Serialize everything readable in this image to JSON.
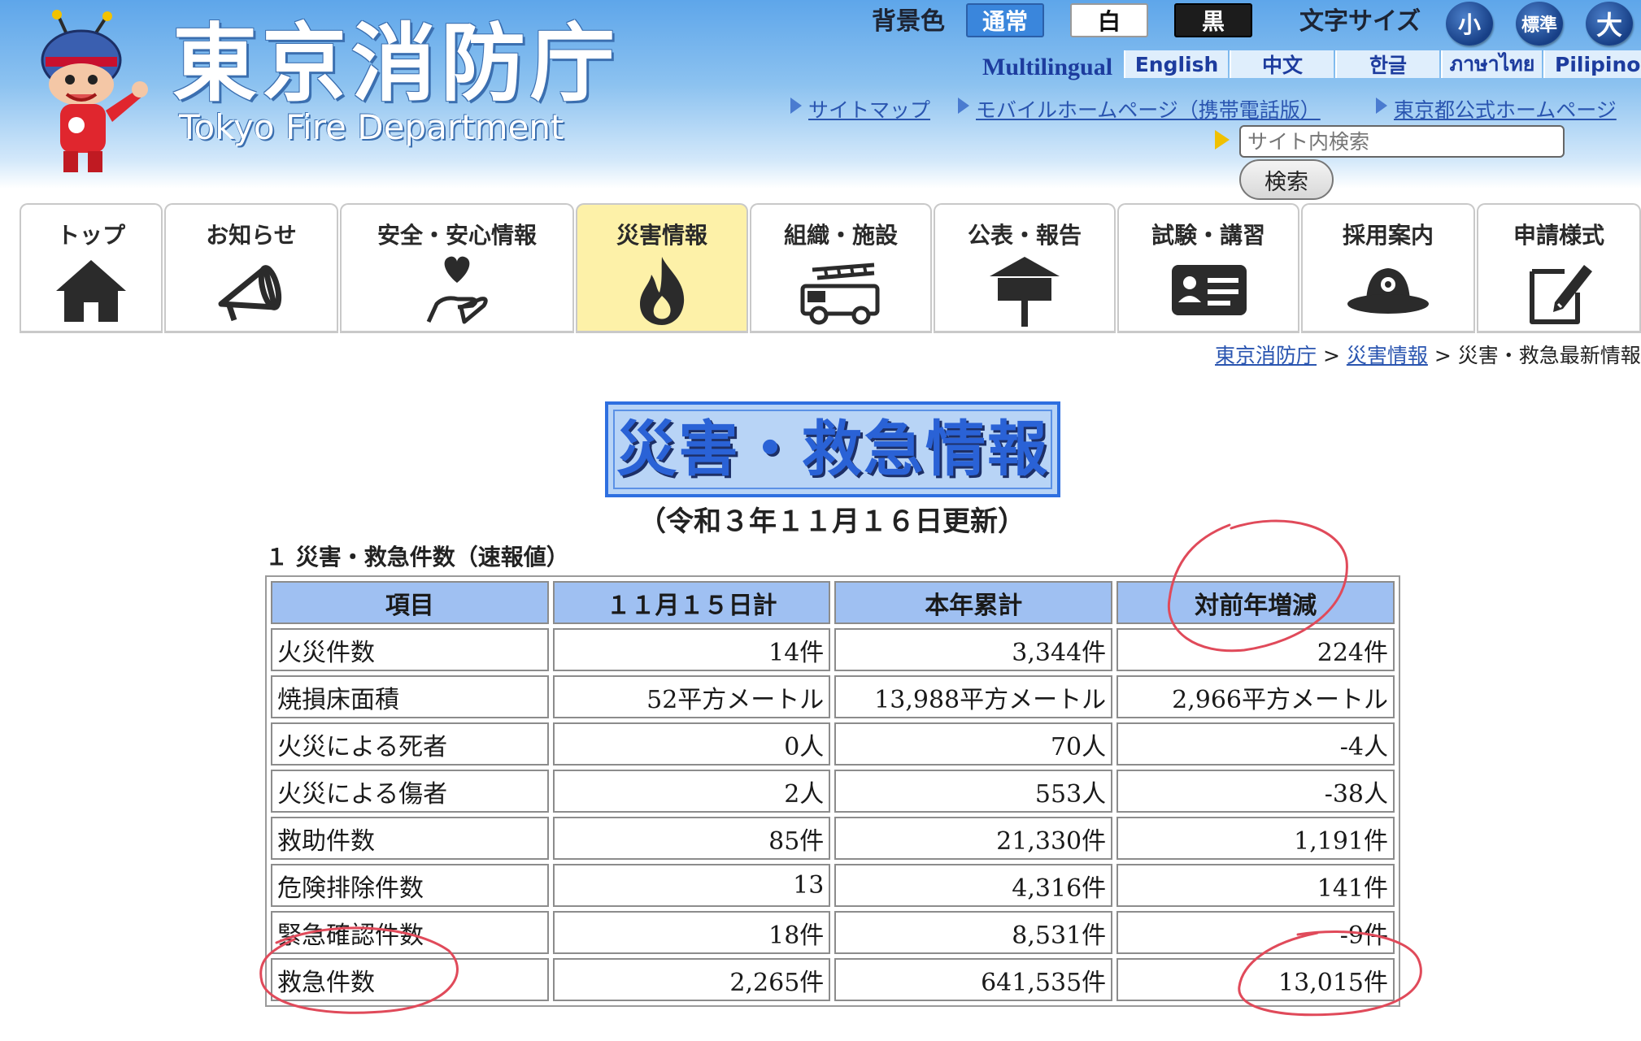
{
  "header": {
    "title_jp": "東京消防庁",
    "title_en": "Tokyo Fire Department",
    "bg_color_label": "背景色",
    "bg_options": [
      "通常",
      "白",
      "黒"
    ],
    "font_size_label": "文字サイズ",
    "font_sizes": [
      "小",
      "標準",
      "大"
    ],
    "multilingual_label": "Multilingual",
    "languages": [
      "English",
      "中文",
      "한글",
      "ภาษาไทย",
      "Pilipino"
    ],
    "links": [
      "サイトマップ",
      "モバイルホームページ（携帯電話版）",
      "東京都公式ホームページ"
    ],
    "search_placeholder": "サイト内検索",
    "search_button": "検索"
  },
  "nav": {
    "active": "災害情報",
    "tabs": [
      {
        "label": "トップ",
        "icon": "home-icon"
      },
      {
        "label": "お知らせ",
        "icon": "megaphone-icon"
      },
      {
        "label": "安全・安心情報",
        "icon": "heart-hand-icon"
      },
      {
        "label": "災害情報",
        "icon": "flame-icon"
      },
      {
        "label": "組織・施設",
        "icon": "fire-truck-icon"
      },
      {
        "label": "公表・報告",
        "icon": "notice-board-icon"
      },
      {
        "label": "試験・講習",
        "icon": "id-card-icon"
      },
      {
        "label": "採用案内",
        "icon": "fire-helmet-icon"
      },
      {
        "label": "申請様式",
        "icon": "form-edit-icon"
      }
    ]
  },
  "breadcrumb": {
    "items": [
      "東京消防庁",
      "災害情報"
    ],
    "separator": ">",
    "current": "災害・救急最新情報"
  },
  "page": {
    "title": "災害・救急情報",
    "updated": "（令和３年１１月１６日更新）",
    "section_heading": "１ 災害・救急件数（速報値）"
  },
  "table": {
    "headers": [
      "項目",
      "１１月１５日計",
      "本年累計",
      "対前年増減"
    ],
    "rows": [
      [
        "火災件数",
        "14件",
        "3,344件",
        "224件"
      ],
      [
        "焼損床面積",
        "52平方メートル",
        "13,988平方メートル",
        "2,966平方メートル"
      ],
      [
        "火災による死者",
        "0人",
        "70人",
        "-4人"
      ],
      [
        "火災による傷者",
        "2人",
        "553人",
        "-38人"
      ],
      [
        "救助件数",
        "85件",
        "21,330件",
        "1,191件"
      ],
      [
        "危険排除件数",
        "13",
        "4,316件",
        "141件"
      ],
      [
        "緊急確認件数",
        "18件",
        "8,531件",
        "-9件"
      ],
      [
        "救急件数",
        "2,265件",
        "641,535件",
        "13,015件"
      ]
    ]
  },
  "colors": {
    "header_blue": "#5ea6ea",
    "active_tab": "#fdf1a8",
    "table_header": "#9fc0f2",
    "link": "#2a55b0",
    "annotation_red": "#e04a5a"
  }
}
